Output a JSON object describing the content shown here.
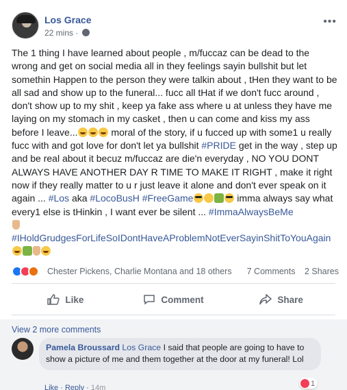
{
  "post": {
    "author": "Los Grace",
    "time": "22 mins",
    "more_label": "•••",
    "body_parts": {
      "p1": "The 1 thing I have learned about people , m/fuccaz can be dead to the wrong and get on social media all in they feelings sayin bullshit but let somethin Happen to the person they were talkin about , tHen they want to be all sad and show up to the funeral... fucc all tHat if we don't fucc around , don't show up to my shit , keep ya fake ass where u at unless they have me laying on my stomach in my casket , then u can come and kiss my ass before I leave...",
      "p2": " moral of the story, if u fucced up with some1 u really fucc with and got love for don't let ya bullshit ",
      "tag_pride": "#PRIDE",
      "p3": " get in the way , step up and be real about it becuz m/fuccaz are die'n everyday , NO YOU DONT ALWAYS HAVE ANOTHER DAY R TIME TO MAKE IT RIGHT , make it right now if they really matter to u r just leave it alone and don't ever speak on it again ... ",
      "tag_los": "#Los",
      "p4": " aka ",
      "tag_locobush": "#LocoBusH",
      "p5": " ",
      "tag_freegame": "#FreeGame",
      "p6": " imma always say what every1 else is tHinkin , I want ever be silent ... ",
      "tag_always": "#ImmaAlwaysBeMe",
      "tag_grudges": "#IHoldGrudgesForLifeSoIDontHaveAProblemNotEverSayinShitToYouAgain"
    },
    "reactions": {
      "names": "Chester Pickens, Charlie Montana and 18 others",
      "comments": "7 Comments",
      "shares": "2 Shares"
    },
    "actions": {
      "like": "Like",
      "comment": "Comment",
      "share": "Share"
    }
  },
  "comments": {
    "view_more": "View 2 more comments",
    "items": [
      {
        "name": "Pamela Broussard",
        "mention": "Los Grace",
        "text": " I said that people are going to have to show a picture of me and them together at the door at my funeral! Lol",
        "reaction_count": "1",
        "like_label": "Like",
        "reply_label": "Reply",
        "time": "14m"
      }
    ]
  },
  "colors": {
    "link": "#385898",
    "muted": "#616770",
    "like": "#1877f2",
    "love": "#f33e58"
  }
}
